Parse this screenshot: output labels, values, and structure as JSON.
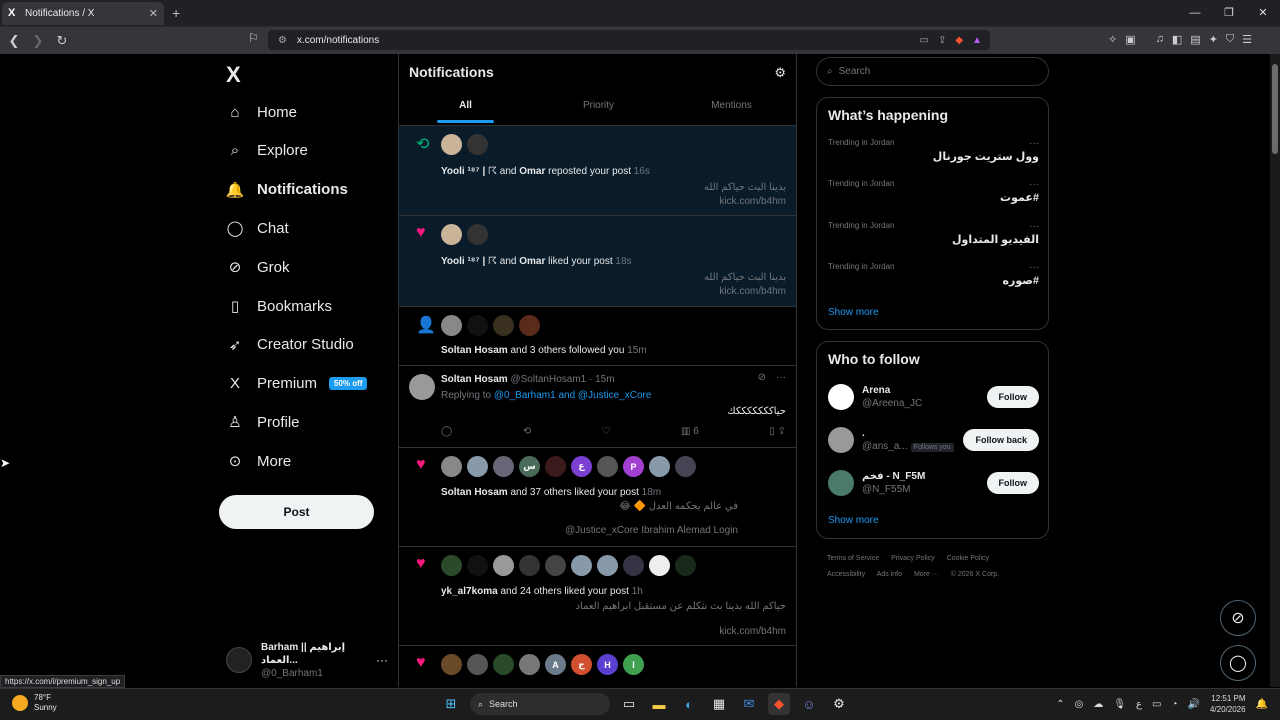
{
  "browser": {
    "tab_title": "Notifications / X",
    "new_tab": "+",
    "url": "x.com/notifications"
  },
  "sidebar": {
    "logo": "X",
    "items": [
      {
        "label": "Home",
        "icon": "home-icon",
        "glyph": "⌂"
      },
      {
        "label": "Explore",
        "icon": "search-icon",
        "glyph": "⌕"
      },
      {
        "label": "Notifications",
        "icon": "bell-icon",
        "glyph": "🔔"
      },
      {
        "label": "Chat",
        "icon": "chat-icon",
        "glyph": "◯"
      },
      {
        "label": "Grok",
        "icon": "grok-icon",
        "glyph": "⊘"
      },
      {
        "label": "Bookmarks",
        "icon": "bookmark-icon",
        "glyph": "▯"
      },
      {
        "label": "Creator Studio",
        "icon": "rocket-icon",
        "glyph": "➶"
      },
      {
        "label": "Premium",
        "icon": "x-icon",
        "glyph": "X"
      },
      {
        "label": "Profile",
        "icon": "person-icon",
        "glyph": "♙"
      },
      {
        "label": "More",
        "icon": "more-icon",
        "glyph": "⊙"
      }
    ],
    "premium_badge": "50% off",
    "post_button": "Post",
    "account": {
      "name": "Barham || إبراهيم العماد...",
      "handle": "@0_Barham1"
    }
  },
  "main": {
    "title": "Notifications",
    "tabs": [
      "All",
      "Priority",
      "Mentions"
    ],
    "notifications": [
      {
        "type": "repost",
        "user1": "Yooli ¹⁸⁷ | ☈",
        "and": "and",
        "user2": "Omar",
        "action": "reposted your post",
        "time": "16s",
        "text": "بدينا البث حياكم الله",
        "link": "kick.com/b4hm"
      },
      {
        "type": "like",
        "user1": "Yooli ¹⁸⁷ | ☈",
        "and": "and",
        "user2": "Omar",
        "action": "liked your post",
        "time": "18s",
        "text": "بدينا البث حياكم الله",
        "link": "kick.com/b4hm"
      },
      {
        "type": "follow",
        "user": "Soltan Hosam",
        "action": "and 3 others followed you",
        "time": "15m"
      },
      {
        "type": "like",
        "user": "Soltan Hosam",
        "action": "and 37 others liked your post",
        "time": "18m",
        "text": "في عالم يحكمه العدل 🔶 😂",
        "text2": "@Justice_xCore Ibrahim Alemad Login"
      },
      {
        "type": "like",
        "user": "yk_al7koma",
        "action": "and 24 others liked your post",
        "time": "1h",
        "text": "حياكم الله بدينا بث نتكلم عن مستقبل ابراهيم العماد",
        "link": "kick.com/b4hm"
      }
    ],
    "reply": {
      "name": "Soltan Hosam",
      "handle": "@SoltanHosam1",
      "time": "15m",
      "replying_label": "Replying to",
      "replying_to": "@0_Barham1 and @Justice_xCore",
      "body": "حياكككككككك",
      "views": "6"
    },
    "row4_avatar_letters": [
      "س",
      "ع",
      "P"
    ],
    "row6_avatar_letters": [
      "A",
      "ج",
      "H",
      "I"
    ]
  },
  "right": {
    "search_placeholder": "Search",
    "happening_title": "What’s happening",
    "trends": [
      {
        "context": "Trending in Jordan",
        "title": "وول ستريت جورنال"
      },
      {
        "context": "Trending in Jordan",
        "title": "#عموت"
      },
      {
        "context": "Trending in Jordan",
        "title": "الفيديو المتداول"
      },
      {
        "context": "Trending in Jordan",
        "title": "#صوره"
      }
    ],
    "show_more": "Show more",
    "follow_title": "Who to follow",
    "follow": [
      {
        "name": "Arena",
        "handle": "@Areena_JC",
        "button": "Follow"
      },
      {
        "name": ".",
        "handle": "@ans_a...",
        "follows_you": "Follows you",
        "button": "Follow back"
      },
      {
        "name": "فخم - N_F5M",
        "handle": "@N_F55M",
        "button": "Follow"
      }
    ],
    "show_more2": "Show more",
    "footer": [
      "Terms of Service",
      "Privacy Policy",
      "Cookie Policy",
      "Accessibility",
      "Ads info",
      "More ···",
      "© 2026 X Corp."
    ]
  },
  "status_url": "https://x.com/i/premium_sign_up",
  "taskbar": {
    "temp": "78°F",
    "weather": "Sunny",
    "search": "Search",
    "time": "12:51 PM",
    "date": "4/20/2026",
    "lang": "ع"
  }
}
